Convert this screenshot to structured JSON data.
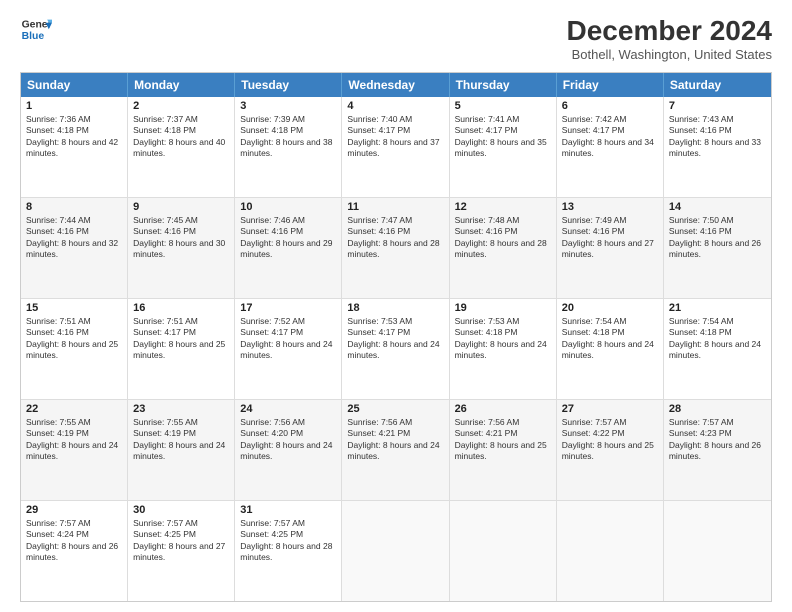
{
  "logo": {
    "line1": "General",
    "line2": "Blue"
  },
  "title": "December 2024",
  "location": "Bothell, Washington, United States",
  "days_of_week": [
    "Sunday",
    "Monday",
    "Tuesday",
    "Wednesday",
    "Thursday",
    "Friday",
    "Saturday"
  ],
  "weeks": [
    [
      {
        "day": 1,
        "rise": "7:36 AM",
        "set": "4:18 PM",
        "daylight": "8 hours and 42 minutes."
      },
      {
        "day": 2,
        "rise": "7:37 AM",
        "set": "4:18 PM",
        "daylight": "8 hours and 40 minutes."
      },
      {
        "day": 3,
        "rise": "7:39 AM",
        "set": "4:18 PM",
        "daylight": "8 hours and 38 minutes."
      },
      {
        "day": 4,
        "rise": "7:40 AM",
        "set": "4:17 PM",
        "daylight": "8 hours and 37 minutes."
      },
      {
        "day": 5,
        "rise": "7:41 AM",
        "set": "4:17 PM",
        "daylight": "8 hours and 35 minutes."
      },
      {
        "day": 6,
        "rise": "7:42 AM",
        "set": "4:17 PM",
        "daylight": "8 hours and 34 minutes."
      },
      {
        "day": 7,
        "rise": "7:43 AM",
        "set": "4:16 PM",
        "daylight": "8 hours and 33 minutes."
      }
    ],
    [
      {
        "day": 8,
        "rise": "7:44 AM",
        "set": "4:16 PM",
        "daylight": "8 hours and 32 minutes."
      },
      {
        "day": 9,
        "rise": "7:45 AM",
        "set": "4:16 PM",
        "daylight": "8 hours and 30 minutes."
      },
      {
        "day": 10,
        "rise": "7:46 AM",
        "set": "4:16 PM",
        "daylight": "8 hours and 29 minutes."
      },
      {
        "day": 11,
        "rise": "7:47 AM",
        "set": "4:16 PM",
        "daylight": "8 hours and 28 minutes."
      },
      {
        "day": 12,
        "rise": "7:48 AM",
        "set": "4:16 PM",
        "daylight": "8 hours and 28 minutes."
      },
      {
        "day": 13,
        "rise": "7:49 AM",
        "set": "4:16 PM",
        "daylight": "8 hours and 27 minutes."
      },
      {
        "day": 14,
        "rise": "7:50 AM",
        "set": "4:16 PM",
        "daylight": "8 hours and 26 minutes."
      }
    ],
    [
      {
        "day": 15,
        "rise": "7:51 AM",
        "set": "4:16 PM",
        "daylight": "8 hours and 25 minutes."
      },
      {
        "day": 16,
        "rise": "7:51 AM",
        "set": "4:17 PM",
        "daylight": "8 hours and 25 minutes."
      },
      {
        "day": 17,
        "rise": "7:52 AM",
        "set": "4:17 PM",
        "daylight": "8 hours and 24 minutes."
      },
      {
        "day": 18,
        "rise": "7:53 AM",
        "set": "4:17 PM",
        "daylight": "8 hours and 24 minutes."
      },
      {
        "day": 19,
        "rise": "7:53 AM",
        "set": "4:18 PM",
        "daylight": "8 hours and 24 minutes."
      },
      {
        "day": 20,
        "rise": "7:54 AM",
        "set": "4:18 PM",
        "daylight": "8 hours and 24 minutes."
      },
      {
        "day": 21,
        "rise": "7:54 AM",
        "set": "4:18 PM",
        "daylight": "8 hours and 24 minutes."
      }
    ],
    [
      {
        "day": 22,
        "rise": "7:55 AM",
        "set": "4:19 PM",
        "daylight": "8 hours and 24 minutes."
      },
      {
        "day": 23,
        "rise": "7:55 AM",
        "set": "4:19 PM",
        "daylight": "8 hours and 24 minutes."
      },
      {
        "day": 24,
        "rise": "7:56 AM",
        "set": "4:20 PM",
        "daylight": "8 hours and 24 minutes."
      },
      {
        "day": 25,
        "rise": "7:56 AM",
        "set": "4:21 PM",
        "daylight": "8 hours and 24 minutes."
      },
      {
        "day": 26,
        "rise": "7:56 AM",
        "set": "4:21 PM",
        "daylight": "8 hours and 25 minutes."
      },
      {
        "day": 27,
        "rise": "7:57 AM",
        "set": "4:22 PM",
        "daylight": "8 hours and 25 minutes."
      },
      {
        "day": 28,
        "rise": "7:57 AM",
        "set": "4:23 PM",
        "daylight": "8 hours and 26 minutes."
      }
    ],
    [
      {
        "day": 29,
        "rise": "7:57 AM",
        "set": "4:24 PM",
        "daylight": "8 hours and 26 minutes."
      },
      {
        "day": 30,
        "rise": "7:57 AM",
        "set": "4:25 PM",
        "daylight": "8 hours and 27 minutes."
      },
      {
        "day": 31,
        "rise": "7:57 AM",
        "set": "4:25 PM",
        "daylight": "8 hours and 28 minutes."
      },
      null,
      null,
      null,
      null
    ]
  ]
}
